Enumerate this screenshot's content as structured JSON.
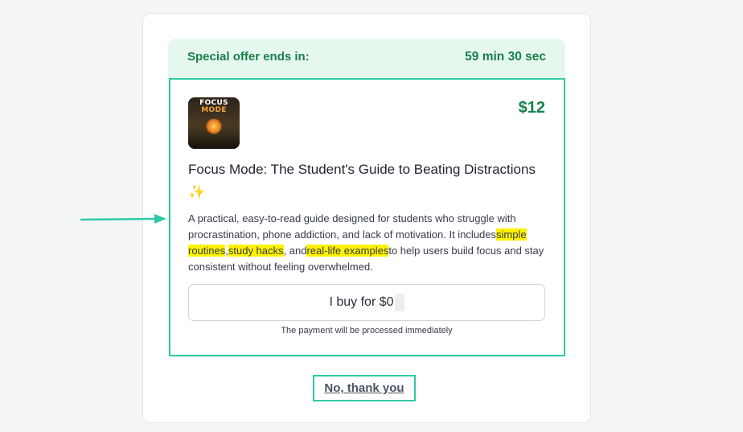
{
  "offer": {
    "label": "Special offer ends in:",
    "timer": "59 min 30 sec"
  },
  "product": {
    "cover_title_line1": "FOCUS",
    "cover_title_line2": "MODE",
    "price": "$12",
    "title": "Focus Mode: The Student's Guide to Beating Distractions",
    "title_emoji": "✨",
    "description": {
      "part1": "A practical, easy-to-read guide designed for students who struggle with procrastination, phone addiction, and lack of motivation. It includes",
      "highlight1": "simple routines",
      "sep1": ",",
      "highlight2": "study hacks",
      "sep2": ", and",
      "highlight3": "real-life examples",
      "part2": "to help users build focus and stay consistent without feeling overwhelmed."
    }
  },
  "buy_button": {
    "label": "I buy for $0"
  },
  "payment_note": "The payment will be processed immediately",
  "decline_link": "No, thank you",
  "colors": {
    "accent_green": "#17804a",
    "banner_bg": "#e6f8ee",
    "annotation_teal": "#2ec9a6",
    "highlight_yellow": "#fff200"
  },
  "icons": {
    "annotation_arrow": "arrow-right-icon",
    "title_emoji": "sparkles-icon"
  }
}
